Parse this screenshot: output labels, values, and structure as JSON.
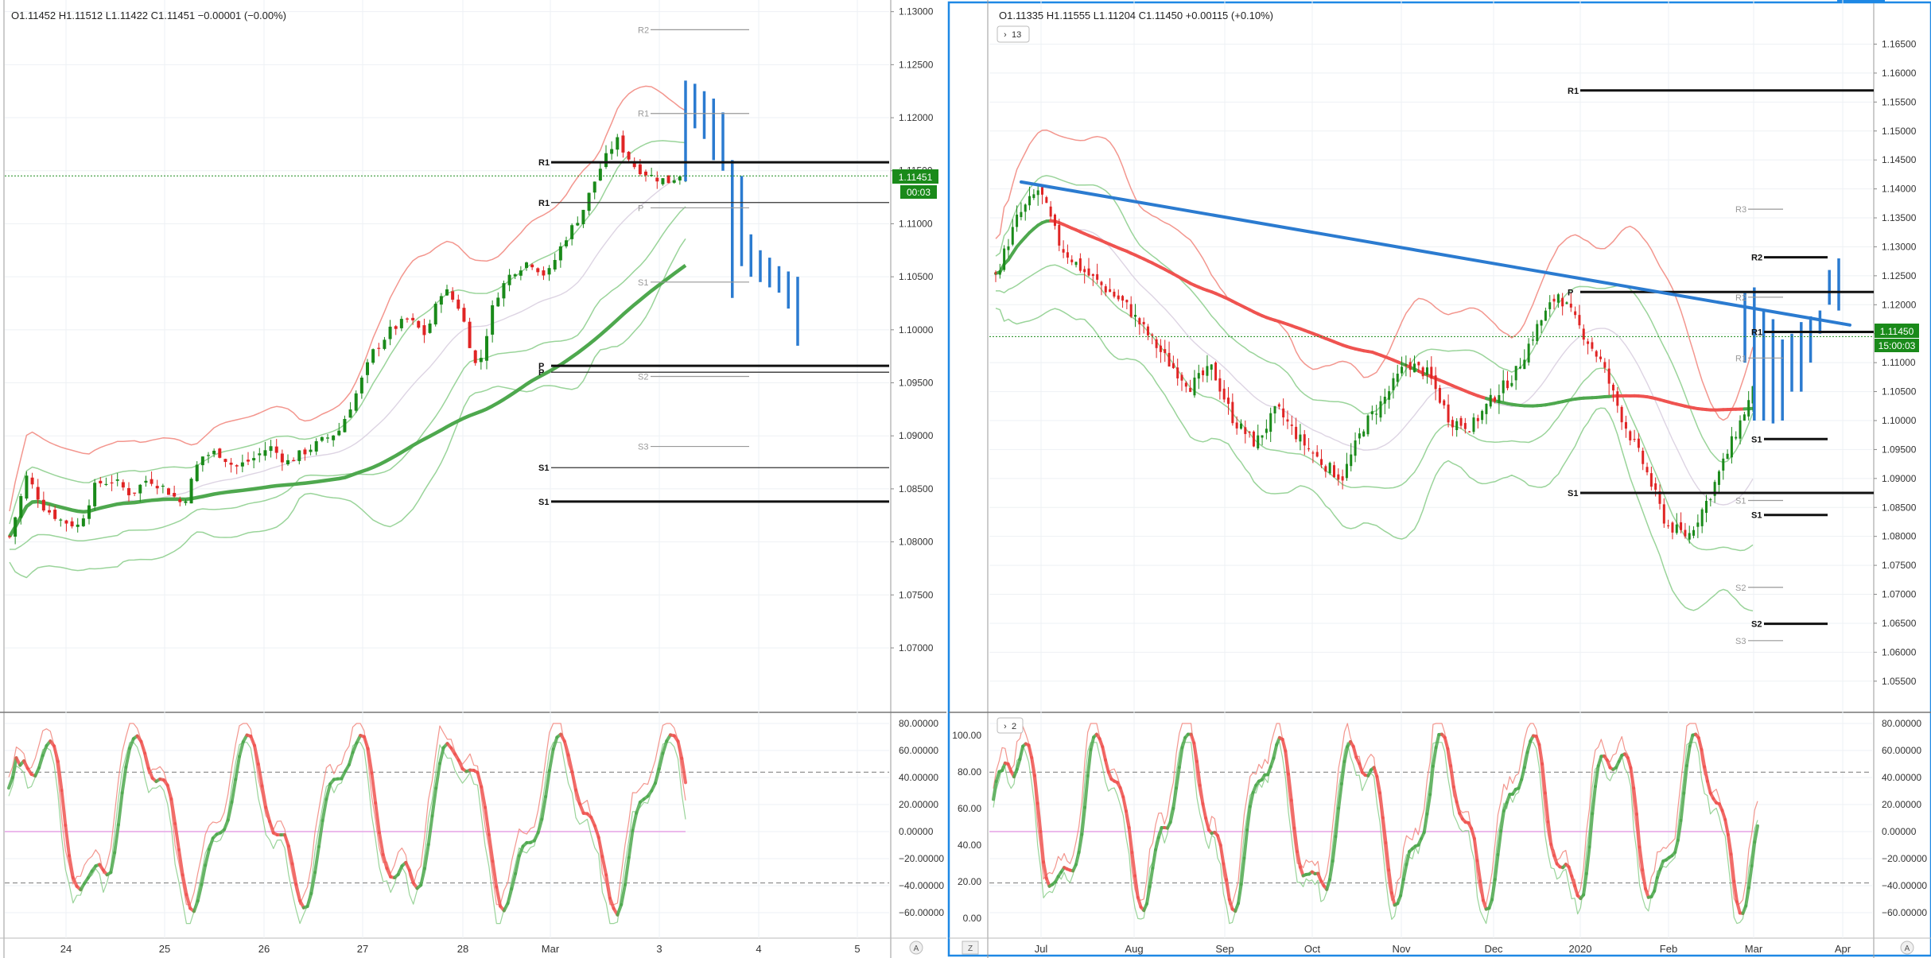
{
  "left": {
    "ohlc": "O1.11452  H1.11512  L1.11422  C1.11451  −0.00001 (−0.00%)",
    "price_ticks": [
      "1.13000",
      "1.12500",
      "1.12000",
      "1.11500",
      "1.11000",
      "1.10500",
      "1.10000",
      "1.09500",
      "1.09000",
      "1.08500",
      "1.08000",
      "1.07500",
      "1.07000"
    ],
    "time_labels": [
      "24",
      "25",
      "26",
      "27",
      "28",
      "Mar",
      "3",
      "4",
      "5"
    ],
    "osc_ticks": [
      "80.00000",
      "60.00000",
      "40.00000",
      "20.00000",
      "0.00000",
      "−20.00000",
      "−40.00000",
      "−60.00000"
    ],
    "last_price": "1.11451",
    "countdown": "00:03",
    "scale_button": "A",
    "pivot_labels": {
      "r2": "R2",
      "r1_faint": "R1",
      "r1_a": "R1",
      "r1_b": "R1",
      "p_faint": "P",
      "s1_faint": "S1",
      "p_a": "P",
      "p_b": "P",
      "s2_faint": "S2",
      "s3_faint": "S3",
      "s1_a": "S1",
      "s1_b": "S1"
    }
  },
  "right": {
    "ohlc": "O1.11335  H1.11555  L1.11204  C1.11450  +0.00115 (+0.10%)",
    "collapse_main": "13",
    "collapse_osc": "2",
    "price_ticks": [
      "1.16500",
      "1.16000",
      "1.15500",
      "1.15000",
      "1.14500",
      "1.14000",
      "1.13500",
      "1.13000",
      "1.12500",
      "1.12000",
      "1.11500",
      "1.11000",
      "1.10500",
      "1.10000",
      "1.09500",
      "1.09000",
      "1.08500",
      "1.08000",
      "1.07500",
      "1.07000",
      "1.06500",
      "1.06000",
      "1.05500"
    ],
    "time_labels": [
      "Jul",
      "Aug",
      "Sep",
      "Oct",
      "Nov",
      "Dec",
      "2020",
      "Feb",
      "Mar",
      "Apr"
    ],
    "osc_left_ticks": [
      "100.00",
      "80.00",
      "60.00",
      "40.00",
      "20.00",
      "0.00"
    ],
    "osc_ticks": [
      "80.00000",
      "60.00000",
      "40.00000",
      "20.00000",
      "0.00000",
      "−20.00000",
      "−40.00000",
      "−60.00000"
    ],
    "last_price": "1.11450",
    "countdown": "15:00:03",
    "scale_button": "A",
    "zoom_button": "Z",
    "pivot_labels": {
      "r1_top": "R1",
      "r3": "R3",
      "r2": "R2",
      "p": "P",
      "r2_faint": "R2",
      "r1": "R1",
      "r1_faint": "R1",
      "s1": "S1",
      "s1_faint": "S1",
      "s1_b": "S1",
      "s2_faint": "S2",
      "s2": "S2",
      "s3": "S3"
    }
  },
  "colors": {
    "up": "#1a8a1a",
    "down": "#e02424",
    "ma_green": "#4ea84e",
    "ma_red": "#ef5350",
    "band_red": "#f28b82",
    "band_green": "#8fcf8f",
    "blue": "#2b7bd0",
    "accent": "#1e88e5"
  },
  "chart_data": [
    {
      "type": "candlestick",
      "title": "",
      "interval_note": "",
      "ylim": [
        1.0655,
        1.1305
      ],
      "ohlc_last": {
        "open": 1.11452,
        "high": 1.11512,
        "low": 1.11422,
        "close": 1.11451,
        "change": -1e-05,
        "change_pct": -0.0
      },
      "x_labels": [
        "24",
        "25",
        "26",
        "27",
        "28",
        "Mar",
        "3",
        "4",
        "5"
      ],
      "close_path": [
        1.0805,
        1.0862,
        1.0832,
        1.082,
        1.0815,
        1.0855,
        1.0858,
        1.0845,
        1.086,
        1.085,
        1.0835,
        1.088,
        1.0885,
        1.087,
        1.0878,
        1.089,
        1.0875,
        1.0885,
        1.0895,
        1.0905,
        1.094,
        1.098,
        1.1,
        1.101,
        1.0995,
        1.104,
        1.102,
        1.096,
        1.103,
        1.1055,
        1.1065,
        1.105,
        1.1085,
        1.111,
        1.115,
        1.118,
        1.1155,
        1.1145,
        1.114,
        1.115
      ],
      "projection_high_low": [
        [
          1.1235,
          1.114
        ],
        [
          1.1232,
          1.119
        ],
        [
          1.1225,
          1.118
        ],
        [
          1.1218,
          1.116
        ],
        [
          1.1205,
          1.115
        ],
        [
          1.116,
          1.103
        ],
        [
          1.1145,
          1.106
        ],
        [
          1.109,
          1.105
        ],
        [
          1.1075,
          1.1045
        ],
        [
          1.1068,
          1.104
        ],
        [
          1.106,
          1.1035
        ],
        [
          1.1055,
          1.102
        ],
        [
          1.105,
          1.0985
        ]
      ],
      "pivots": [
        {
          "label": "R2",
          "value": 1.1283,
          "style": "faint"
        },
        {
          "label": "R1",
          "value": 1.1204,
          "style": "faint"
        },
        {
          "label": "R1",
          "value": 1.1158,
          "style": "bold"
        },
        {
          "label": "R1",
          "value": 1.112,
          "style": "thin"
        },
        {
          "label": "P",
          "value": 1.1115,
          "style": "faint"
        },
        {
          "label": "S1",
          "value": 1.1045,
          "style": "faint"
        },
        {
          "label": "P",
          "value": 1.0966,
          "style": "bold"
        },
        {
          "label": "P",
          "value": 1.096,
          "style": "thin"
        },
        {
          "label": "S2",
          "value": 1.0956,
          "style": "faint"
        },
        {
          "label": "S3",
          "value": 1.089,
          "style": "faint"
        },
        {
          "label": "S1",
          "value": 1.087,
          "style": "thin"
        },
        {
          "label": "S1",
          "value": 1.0838,
          "style": "bold"
        }
      ],
      "oscillator": {
        "ylim": [
          -70,
          80
        ],
        "levels": [
          44,
          -38,
          0
        ]
      }
    },
    {
      "type": "candlestick",
      "title": "",
      "interval_note": "",
      "ylim": [
        1.0525,
        1.1685
      ],
      "ohlc_last": {
        "open": 1.11335,
        "high": 1.11555,
        "low": 1.11204,
        "close": 1.1145,
        "change": 0.00115,
        "change_pct": 0.1
      },
      "x_labels": [
        "Jul",
        "Aug",
        "Sep",
        "Oct",
        "Nov",
        "Dec",
        "2020",
        "Feb",
        "Mar",
        "Apr"
      ],
      "close_path": [
        1.125,
        1.135,
        1.14,
        1.13,
        1.126,
        1.123,
        1.12,
        1.115,
        1.11,
        1.106,
        1.109,
        1.1,
        1.096,
        1.102,
        1.097,
        1.093,
        1.09,
        1.099,
        1.104,
        1.11,
        1.108,
        1.1,
        1.099,
        1.104,
        1.108,
        1.116,
        1.122,
        1.116,
        1.11,
        1.1,
        1.092,
        1.082,
        1.08,
        1.087,
        1.096,
        1.105
      ],
      "projection_high_low": [
        [
          1.122,
          1.11
        ],
        [
          1.123,
          1.1
        ],
        [
          1.119,
          1.1
        ],
        [
          1.1175,
          1.0995
        ],
        [
          1.114,
          1.1
        ],
        [
          1.115,
          1.105
        ],
        [
          1.117,
          1.105
        ],
        [
          1.118,
          1.11
        ],
        [
          1.119,
          1.115
        ],
        [
          1.126,
          1.12
        ],
        [
          1.128,
          1.119
        ]
      ],
      "pivots": [
        {
          "label": "R1",
          "value": 1.157,
          "style": "bold"
        },
        {
          "label": "R3",
          "value": 1.1365,
          "style": "faint"
        },
        {
          "label": "R2",
          "value": 1.1282,
          "style": "bold"
        },
        {
          "label": "P",
          "value": 1.1222,
          "style": "bold"
        },
        {
          "label": "R2",
          "value": 1.1213,
          "style": "faint"
        },
        {
          "label": "R1",
          "value": 1.1153,
          "style": "bold"
        },
        {
          "label": "R1",
          "value": 1.1108,
          "style": "faint"
        },
        {
          "label": "S1",
          "value": 1.0968,
          "style": "bold"
        },
        {
          "label": "S1",
          "value": 1.0875,
          "style": "bold"
        },
        {
          "label": "S1",
          "value": 1.0862,
          "style": "faint"
        },
        {
          "label": "S1",
          "value": 1.0837,
          "style": "bold"
        },
        {
          "label": "S2",
          "value": 1.0712,
          "style": "faint"
        },
        {
          "label": "S2",
          "value": 1.0649,
          "style": "bold"
        },
        {
          "label": "S3",
          "value": 1.062,
          "style": "faint"
        }
      ],
      "trendline": [
        [
          1.1412,
          0
        ],
        [
          1.1165,
          1
        ]
      ],
      "oscillator": {
        "ylim": [
          -70,
          80
        ],
        "levels": [
          44,
          -38,
          0
        ]
      }
    }
  ]
}
